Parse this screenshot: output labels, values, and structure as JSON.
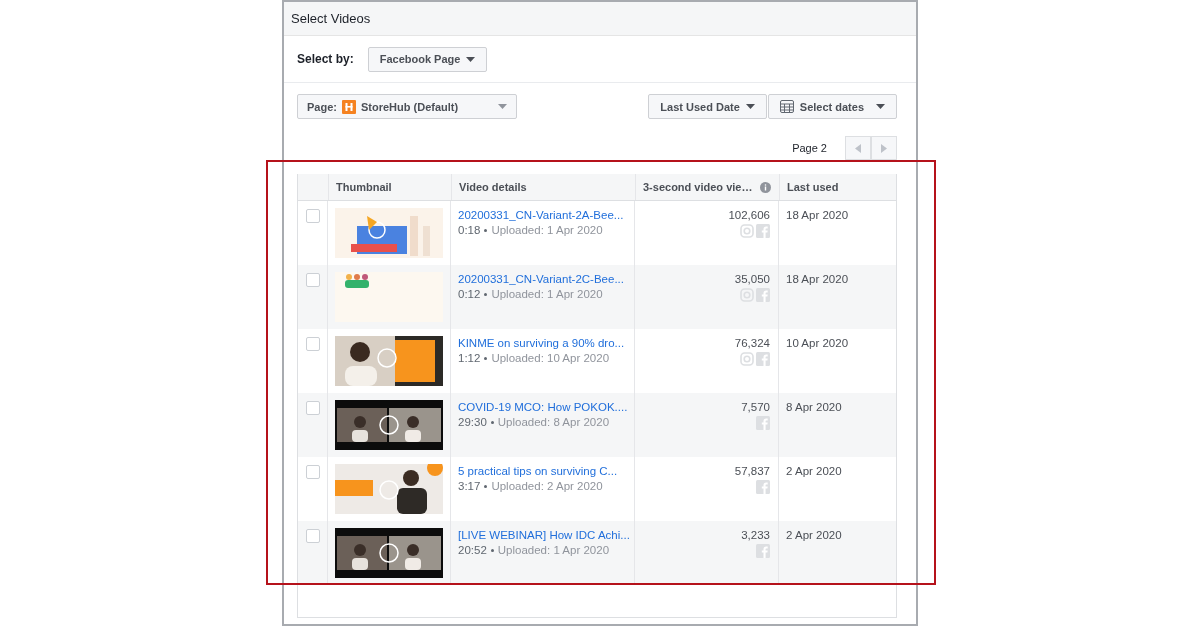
{
  "dialog": {
    "title": "Select Videos"
  },
  "select_by": {
    "label": "Select by:",
    "value": "Facebook Page"
  },
  "page_filter": {
    "label": "Page:",
    "value": "StoreHub (Default)"
  },
  "sort": {
    "value": "Last Used Date"
  },
  "date_filter": {
    "value": "Select dates"
  },
  "pagination": {
    "label": "Page 2"
  },
  "table": {
    "columns": [
      "Thumbnail",
      "Video details",
      "3-second video vie…",
      "Last used"
    ],
    "rows": [
      {
        "checked": false,
        "title": "20200331_CN-Variant-2A-Bee...",
        "duration": "0:18",
        "uploaded": "Uploaded: 1 Apr 2020",
        "views": "102,606",
        "platforms": [
          {
            "kind": "instagram"
          },
          {
            "kind": "facebook"
          }
        ],
        "last_used": "18 Apr 2020"
      },
      {
        "checked": false,
        "title": "20200331_CN-Variant-2C-Bee...",
        "duration": "0:12",
        "uploaded": "Uploaded: 1 Apr 2020",
        "views": "35,050",
        "platforms": [
          {
            "kind": "instagram"
          },
          {
            "kind": "facebook"
          }
        ],
        "last_used": "18 Apr 2020"
      },
      {
        "checked": false,
        "title": "KINME on surviving a 90% dro...",
        "duration": "1:12",
        "uploaded": "Uploaded: 10 Apr 2020",
        "views": "76,324",
        "platforms": [
          {
            "kind": "instagram"
          },
          {
            "kind": "facebook"
          }
        ],
        "last_used": "10 Apr 2020"
      },
      {
        "checked": false,
        "title": "COVID-19 MCO: How POKOK....",
        "duration": "29:30",
        "uploaded": "Uploaded: 8 Apr 2020",
        "views": "7,570",
        "platforms": [
          {
            "kind": "facebook"
          }
        ],
        "last_used": "8 Apr 2020"
      },
      {
        "checked": false,
        "title": "5 practical tips on surviving C...",
        "duration": "3:17",
        "uploaded": "Uploaded: 2 Apr 2020",
        "views": "57,837",
        "platforms": [
          {
            "kind": "facebook"
          }
        ],
        "last_used": "2 Apr 2020"
      },
      {
        "checked": false,
        "title": "[LIVE WEBINAR] How IDC Achi...",
        "duration": "20:52",
        "uploaded": "Uploaded: 1 Apr 2020",
        "views": "3,233",
        "platforms": [
          {
            "kind": "facebook"
          }
        ],
        "last_used": "2 Apr 2020"
      }
    ]
  }
}
